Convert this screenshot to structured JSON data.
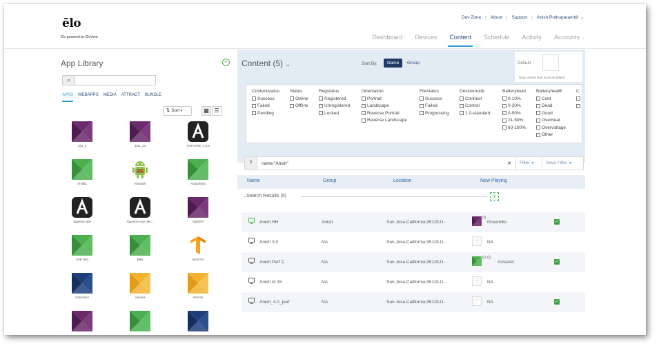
{
  "header": {
    "logo": "ēlo",
    "logo_sub": "Elo powered by EloView",
    "top_links": [
      "Dev Zone",
      "About",
      "Support",
      "Anish Puthuparambil"
    ],
    "nav": [
      "Dashboard",
      "Devices",
      "Content",
      "Schedule",
      "Activity",
      "Accounts"
    ],
    "active_nav": "Content"
  },
  "library": {
    "title": "App Library",
    "search_placeholder": "",
    "tabs": [
      "APKS",
      "WEBAPPS",
      "MEDIA",
      "ATTRACT",
      "BUNDLE"
    ],
    "active_tab": "APKS",
    "sort_label": "Sort",
    "apps": [
      {
        "label": "121_2",
        "icon": "purple-pyramid"
      },
      {
        "label": "1to1_23",
        "icon": "purple-pyramid"
      },
      {
        "label": "ACTIVATE_4.5.4",
        "icon": "activate-logo"
      },
      {
        "label": "AI-8B1",
        "icon": "green-pyramid"
      },
      {
        "label": "Airwatch",
        "icon": "android-robot"
      },
      {
        "label": "AngryBirds",
        "icon": "green-pyramid"
      },
      {
        "label": "Appetize apk",
        "icon": "activate-logo"
      },
      {
        "label": "Appetize App_Me...",
        "icon": "activate-logo"
      },
      {
        "label": "Applizer",
        "icon": "purple-pyramid"
      },
      {
        "label": "AVB Test",
        "icon": "green-pyramid"
      },
      {
        "label": "Bike",
        "icon": "green-pyramid"
      },
      {
        "label": "body-rec",
        "icon": "tensorflow-logo"
      },
      {
        "label": "Calculator",
        "icon": "blue-pyramid"
      },
      {
        "label": "camera",
        "icon": "yellow-pyramid"
      },
      {
        "label": "chrome",
        "icon": "yellow-pyramid"
      },
      {
        "label": "",
        "icon": "purple-pyramid"
      },
      {
        "label": "",
        "icon": "green-pyramid"
      },
      {
        "label": "",
        "icon": "blue-pyramid"
      }
    ]
  },
  "content": {
    "title": "Content (5)",
    "sort_by_label": "Sort By:",
    "sort_options": [
      "Name",
      "Group"
    ],
    "active_sort": "Name",
    "default_label": "Default:",
    "default_hint": "Drag content here to set as default",
    "filters": [
      {
        "heading": "Contentstatus",
        "options": [
          "Success",
          "Failed",
          "Pending"
        ]
      },
      {
        "heading": "Status",
        "options": [
          "Online",
          "Offline"
        ]
      },
      {
        "heading": "Regstatus",
        "options": [
          "Registered",
          "Unregistered",
          "Locked"
        ]
      },
      {
        "heading": "Orientation",
        "options": [
          "Portrait",
          "Landscape",
          "Reverse Portrait",
          "Reverse Landscape"
        ]
      },
      {
        "heading": "Filestatus",
        "options": [
          "Success",
          "Failed",
          "Progressing"
        ]
      },
      {
        "heading": "Devicemode",
        "options": [
          "Connect",
          "Control",
          "1.0-standard"
        ]
      },
      {
        "heading": "Batterylevel",
        "options": [
          "0-10%",
          "0-20%",
          "0-50%",
          "21-59%",
          "60-100%"
        ]
      },
      {
        "heading": "Batteryhealth",
        "options": [
          "Cold",
          "Dead",
          "Good",
          "Overheat",
          "Overvoltage",
          "Other"
        ]
      },
      {
        "heading": "C",
        "options": [
          "",
          ""
        ]
      }
    ],
    "search_query": "name:\"Anish\"",
    "filter_btn": "Filter",
    "save_filter_btn": "Save Filter",
    "columns": [
      "Name",
      "Group",
      "Location",
      "Now Playing"
    ],
    "search_results_label": "Search Results (5)",
    "rows": [
      {
        "name": "Anish HH",
        "group": "Anish",
        "location": "San Jose,California,95119,U...",
        "now_playing": "Greenbits",
        "thumb": "purple",
        "checked": true,
        "online": true
      },
      {
        "name": "Anish 3.0",
        "group": "NA",
        "location": "San Jose,California,95119,U...",
        "now_playing": "NA",
        "thumb": "empty",
        "checked": false,
        "online": false
      },
      {
        "name": "Anish Perf C",
        "group": "NA",
        "location": "San Jose,California,95119,U...",
        "now_playing": "Amazon",
        "thumb": "green",
        "checked": true,
        "online": false
      },
      {
        "name": "Anish rk 15",
        "group": "NA",
        "location": "San Jose,California,95119,U...",
        "now_playing": "NA",
        "thumb": "empty",
        "checked": false,
        "online": false
      },
      {
        "name": "Anish_4.0_perf",
        "group": "NA",
        "location": "San Jose,California,95119,U...",
        "now_playing": "NA",
        "thumb": "empty",
        "checked": true,
        "online": false
      }
    ]
  },
  "colors": {
    "accent": "#2e9bd6",
    "navy": "#1e3a66",
    "green": "#43a047",
    "purple": "#6a2a6b",
    "yellow": "#f2b230",
    "blue": "#1f3f7a"
  }
}
